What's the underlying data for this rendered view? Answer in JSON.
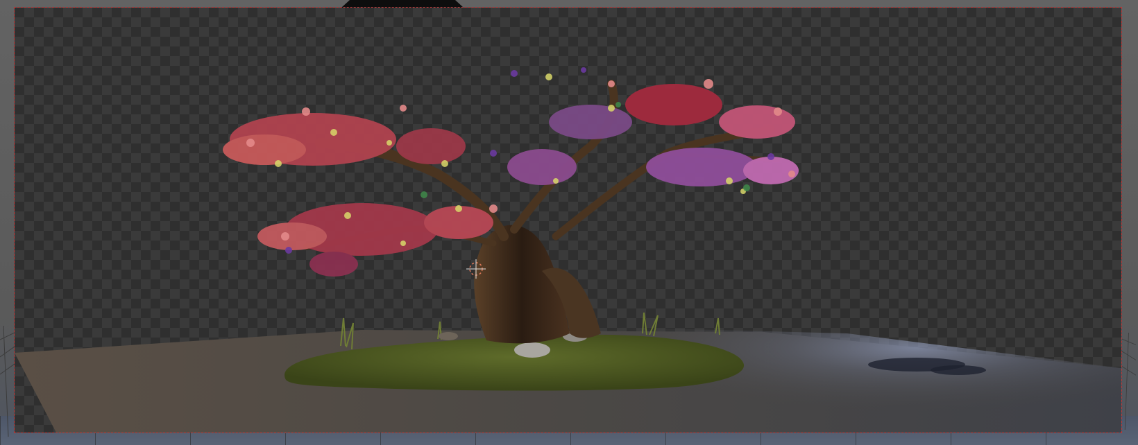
{
  "viewport": {
    "mode": "camera-view",
    "render_preview": "bonsai-tree-scene",
    "colors": {
      "background": "#5e5e5e",
      "transparency_checker_dark": "#2f2f2f",
      "transparency_checker_light": "#3a3a3a",
      "camera_frame_outline": "#c23a3a",
      "ground_plane": "#4a4744",
      "grass": "#4c5a24",
      "trunk": "#3a2a1c"
    },
    "icons": [
      "camera-frame-handle",
      "origin-crosshair-icon"
    ]
  }
}
